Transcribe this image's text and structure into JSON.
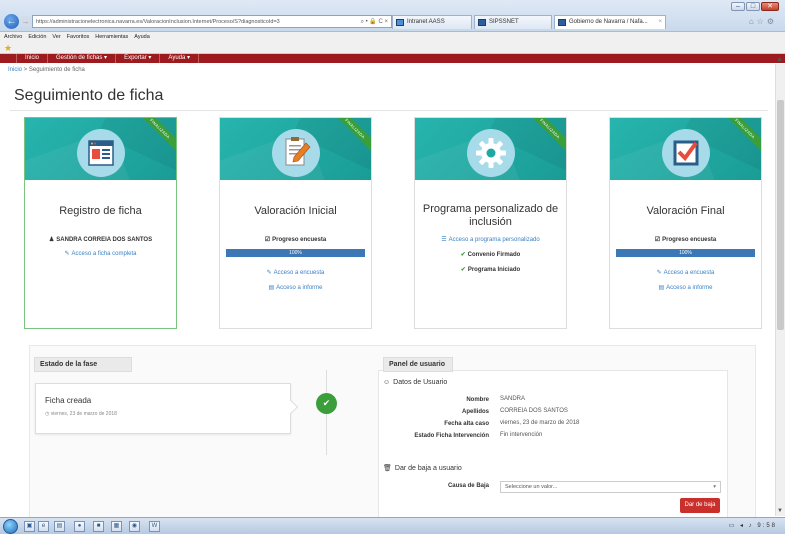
{
  "browser": {
    "url": "https://administracionelectronica.navarra.es/ValoracionInclusion.Internet/Proceso/S?diagnosticoId=3",
    "address_tools": "⌕ • 🔒 C ×",
    "tabs": [
      {
        "label": "Intranet AASS"
      },
      {
        "label": "SIPSSNET"
      },
      {
        "label": "Gobierno de Navarra / Nafa...",
        "close": "×"
      }
    ],
    "menu": [
      "Archivo",
      "Edición",
      "Ver",
      "Favoritos",
      "Herramientas",
      "Ayuda"
    ]
  },
  "app_nav": {
    "items": [
      "Inicio",
      "Gestión de fichas ▾",
      "Exportar ▾",
      "Ayuda ▾"
    ]
  },
  "breadcrumb": {
    "home": "Inicio",
    "sep": " > ",
    "current": "Seguimiento de ficha"
  },
  "page": {
    "title": "Seguimiento de ficha"
  },
  "cards": [
    {
      "title": "Registro de ficha",
      "ribbon": "FINALIZADA",
      "user_icon": "user-icon",
      "user": "SANDRA CORREIA DOS SANTOS",
      "link": "Acceso a ficha completa"
    },
    {
      "title": "Valoración Inicial",
      "ribbon": "FINALIZADA",
      "progress_label": "Progreso encuesta",
      "progress_value": "100%",
      "progress_fraction": 1.0,
      "link1": "Acceso a encuesta",
      "link2": "Acceso a informe"
    },
    {
      "title": "Programa personalizado de inclusión",
      "ribbon": "FINALIZADA",
      "link": "Acceso a programa personalizado",
      "item1": "Convenio Firmado",
      "item2": "Programa Iniciado"
    },
    {
      "title": "Valoración Final",
      "ribbon": "FINALIZADA",
      "progress_label": "Progreso encuesta",
      "progress_value": "100%",
      "progress_fraction": 1.0,
      "link1": "Acceso a encuesta",
      "link2": "Acceso a informe"
    }
  ],
  "estado": {
    "header": "Estado de la fase",
    "phase_title": "Ficha creada",
    "phase_date": "viernes, 23 de marzo de 2018"
  },
  "panel": {
    "header": "Panel de usuario",
    "datos_title": "Datos de Usuario",
    "fields": [
      {
        "label": "Nombre",
        "value": "SANDRA"
      },
      {
        "label": "Apellidos",
        "value": "CORREIA DOS SANTOS"
      },
      {
        "label": "Fecha alta caso",
        "value": "viernes, 23 de marzo de 2018"
      },
      {
        "label": "Estado Ficha Intervención",
        "value": "Fin intervención"
      }
    ],
    "baja_title": "Dar de baja a usuario",
    "causa_label": "Causa de Baja",
    "select_placeholder": "Seleccione un valor...",
    "button": "Dar de baja"
  },
  "taskbar": {
    "clock": "9:58"
  },
  "colors": {
    "teal": "#1ea8a2",
    "nav_red": "#9d1b1e",
    "success": "#3a9e3a",
    "progress": "#3b78b5",
    "danger": "#c9302c",
    "link": "#3b82c4"
  }
}
